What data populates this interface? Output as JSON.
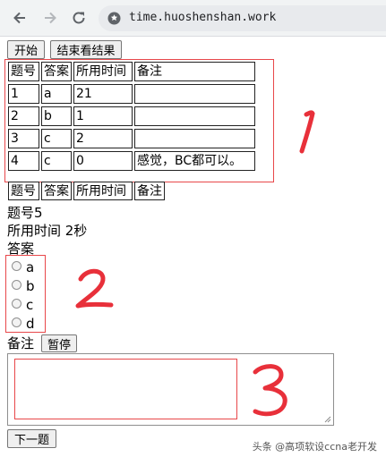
{
  "browser": {
    "url": "time.huoshenshan.work"
  },
  "toolbar": {
    "start_label": "开始",
    "end_label": "结束看结果"
  },
  "results_table": {
    "headers": [
      "题号",
      "答案",
      "所用时间",
      "备注"
    ],
    "rows": [
      [
        "1",
        "a",
        "21",
        ""
      ],
      [
        "2",
        "b",
        "1",
        ""
      ],
      [
        "3",
        "c",
        "2",
        ""
      ],
      [
        "4",
        "c",
        "0",
        "感觉，BC都可以。"
      ]
    ]
  },
  "question_header": [
    "题号",
    "答案",
    "所用时间",
    "备注"
  ],
  "question": {
    "number_text": "题号5",
    "time_text": "所用时间 2秒",
    "answer_label": "答案",
    "options": [
      "a",
      "b",
      "c",
      "d"
    ],
    "note_label": "备注",
    "pause_label": "暂停",
    "next_label": "下一题"
  },
  "annotations": {
    "n1": "1",
    "n2": "2",
    "n3": "3",
    "color": "#e8303a"
  },
  "watermark": "头条 @高项软设ccna老开发"
}
